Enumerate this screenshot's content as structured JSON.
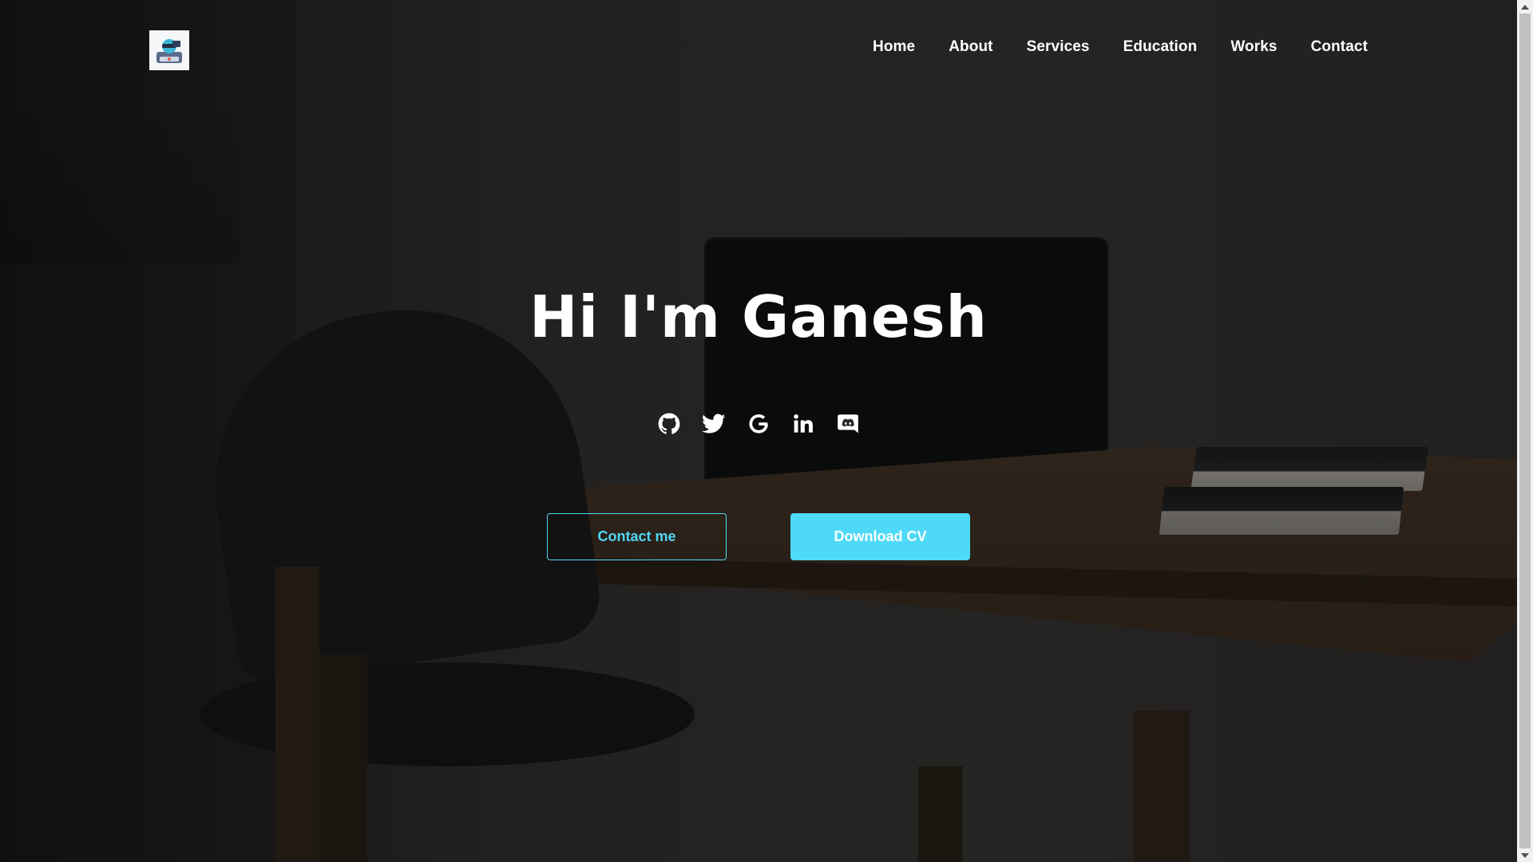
{
  "nav": {
    "logo_alt": "site logo",
    "links": [
      {
        "label": "Home"
      },
      {
        "label": "About"
      },
      {
        "label": "Services"
      },
      {
        "label": "Education"
      },
      {
        "label": "Works"
      },
      {
        "label": "Contact"
      }
    ]
  },
  "hero": {
    "title": "Hi I'm Ganesh",
    "socials": [
      {
        "icon": "github-icon"
      },
      {
        "icon": "twitter-icon"
      },
      {
        "icon": "google-icon"
      },
      {
        "icon": "linkedin-icon"
      },
      {
        "icon": "discord-icon"
      }
    ],
    "contact_button": "Contact me",
    "download_button": "Download CV"
  },
  "colors": {
    "accent": "#4fd9f8",
    "text": "#ffffff"
  }
}
